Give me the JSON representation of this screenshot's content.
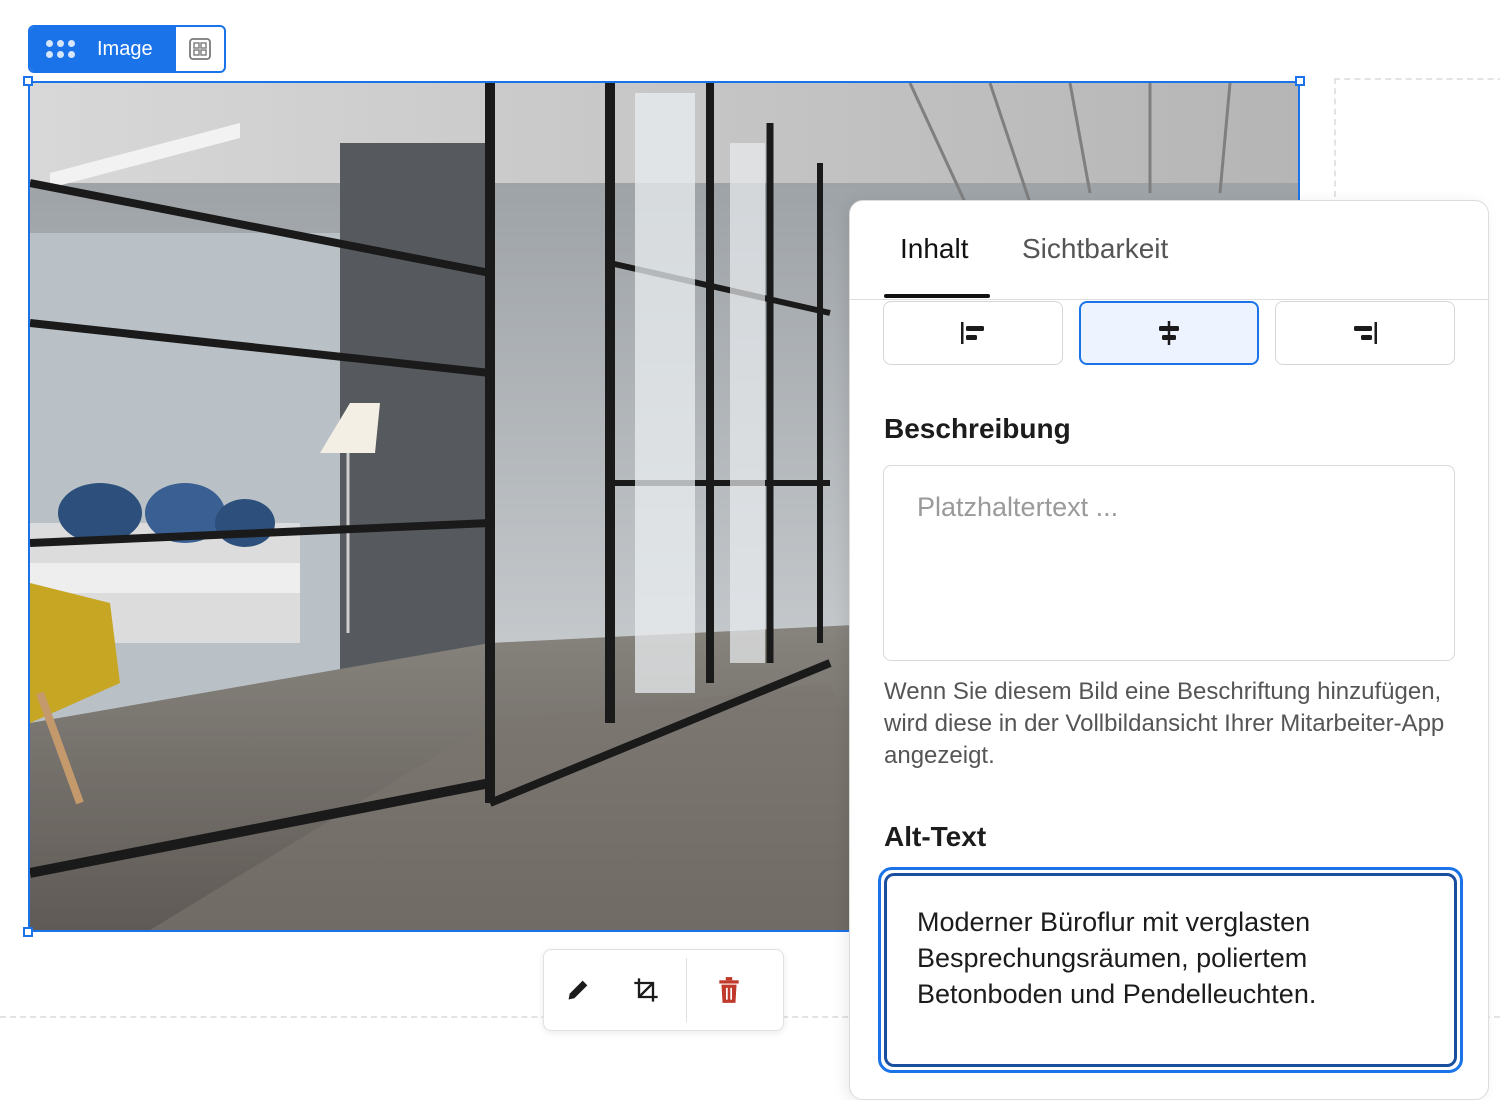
{
  "block": {
    "label": "Image"
  },
  "panel": {
    "tabs": [
      {
        "label": "Inhalt",
        "active": true
      },
      {
        "label": "Sichtbarkeit",
        "active": false
      }
    ],
    "alignment": {
      "options": [
        "align-left",
        "align-center",
        "align-right"
      ],
      "selected": "align-center"
    },
    "description": {
      "label": "Beschreibung",
      "placeholder": "Platzhaltertext ...",
      "value": "",
      "help": "Wenn Sie diesem Bild eine Beschriftung hinzufügen, wird diese in der Vollbildansicht Ihrer Mitarbeiter-App angezeigt."
    },
    "alt_text": {
      "label": "Alt-Text",
      "value": "Moderner Büroflur mit verglasten Besprechungsräumen, poliertem Betonboden und Pendelleuchten."
    }
  },
  "floating_toolbar": {
    "icons": [
      "pencil-icon",
      "crop-icon",
      "trash-icon"
    ]
  },
  "colors": {
    "accent": "#1a73e8",
    "delete": "#c0392b",
    "selected_bg": "#eef4ff"
  }
}
